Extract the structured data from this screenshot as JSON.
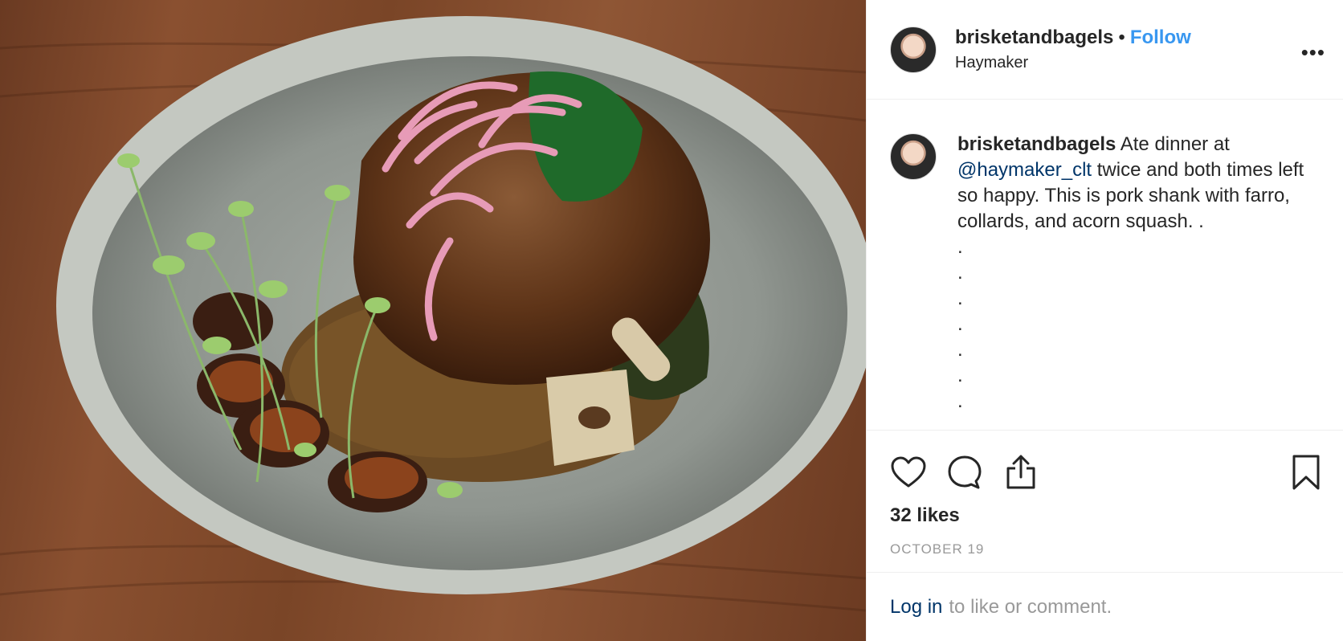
{
  "photo": {
    "alt_subject": "pork-shank-dish-photo"
  },
  "header": {
    "username": "brisketandbagels",
    "separator": "•",
    "follow_label": "Follow",
    "location": "Haymaker",
    "more_label": "•••"
  },
  "caption": {
    "username": "brisketandbagels",
    "text_before_mention": " Ate dinner at ",
    "mention": "@haymaker_clt",
    "text_after_mention": " twice and both times left so happy. This is pork shank with farro, collards, and acorn squash. .",
    "dots": [
      ".",
      ".",
      ".",
      ".",
      ".",
      ".",
      "."
    ]
  },
  "actions": {
    "icons": [
      "heart-icon",
      "comment-icon",
      "share-icon",
      "bookmark-icon"
    ]
  },
  "likes": "32 likes",
  "date": "OCTOBER 19",
  "login": {
    "link": "Log in",
    "text": "to like or comment."
  },
  "colors": {
    "link_blue": "#3897f0",
    "mention_navy": "#003569",
    "muted_gray": "#999999",
    "text": "#262626"
  }
}
